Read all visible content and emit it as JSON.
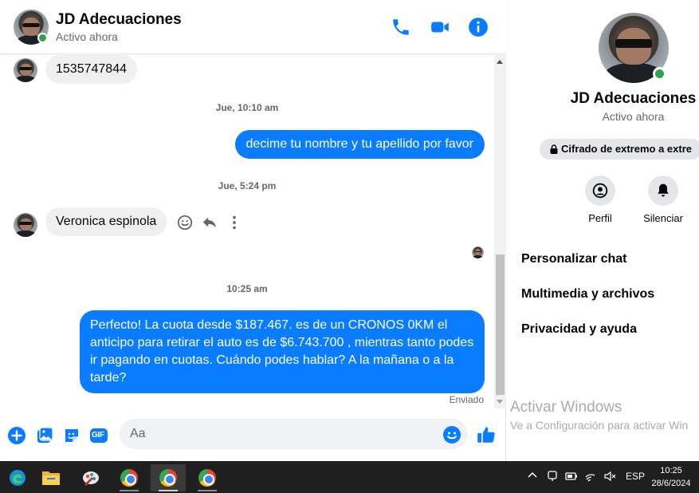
{
  "header": {
    "title": "JD Adecuaciones",
    "status": "Activo ahora"
  },
  "messages": {
    "items": [
      {
        "text": "1535747844"
      },
      {
        "text": "Jue, 10:10 am"
      },
      {
        "text": "decime tu nombre y tu apellido por favor"
      },
      {
        "text": "Jue, 5:24 pm"
      },
      {
        "text": "Veronica espinola"
      },
      {
        "text": "10:25 am"
      },
      {
        "text": "Perfecto! La cuota desde $187.467. es de un CRONOS 0KM el anticipo para retirar el auto es de $6.743.700 , mientras tanto podes ir pagando en cuotas. Cuándo podes hablar? A la mañana o a la tarde?"
      }
    ],
    "sent_status": "Enviado"
  },
  "composer": {
    "gif_label": "GIF",
    "placeholder": "Aa"
  },
  "panel": {
    "name": "JD Adecuaciones",
    "status": "Activo ahora",
    "e2e": "Cifrado de extremo a extre",
    "actions": [
      {
        "label": "Perfil"
      },
      {
        "label": "Silenciar"
      }
    ],
    "menu": [
      {
        "label": "Personalizar chat"
      },
      {
        "label": "Multimedia y archivos"
      },
      {
        "label": "Privacidad y ayuda"
      }
    ]
  },
  "watermark": {
    "title": "Activar Windows",
    "subtitle": "Ve a Configuración para activar Win"
  },
  "taskbar": {
    "language": "ESP",
    "time": "10:25",
    "date": "28/6/2024"
  },
  "colors": {
    "accent": "#0a7cff",
    "online": "#31a24c",
    "incoming_bubble": "#f0f0f0",
    "taskbar": "#1f1f1f"
  }
}
